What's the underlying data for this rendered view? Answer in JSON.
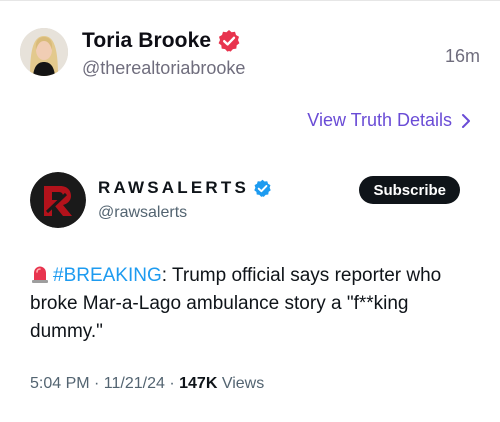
{
  "truth": {
    "author_name": "Toria Brooke",
    "author_handle": "@therealtoriabrooke",
    "time_ago": "16m",
    "view_details_label": "View Truth Details",
    "accent_color": "#6a4cd6",
    "badge_color": "#e8344e"
  },
  "post": {
    "author_name": "RAWSALERTS",
    "author_handle": "@rawsalerts",
    "subscribe_label": "Subscribe",
    "siren_icon": "police-light-emoji",
    "hashtag": "#BREAKING",
    "text_after_hashtag": ": Trump official says reporter who broke Mar-a-Lago ambulance story a \"f**king dummy.\"",
    "timestamp": "5:04 PM · 11/21/24 · ",
    "views_count": "147K",
    "views_label": " Views",
    "hashtag_color": "#1d9bf0",
    "badge_color": "#1d9bf0"
  }
}
